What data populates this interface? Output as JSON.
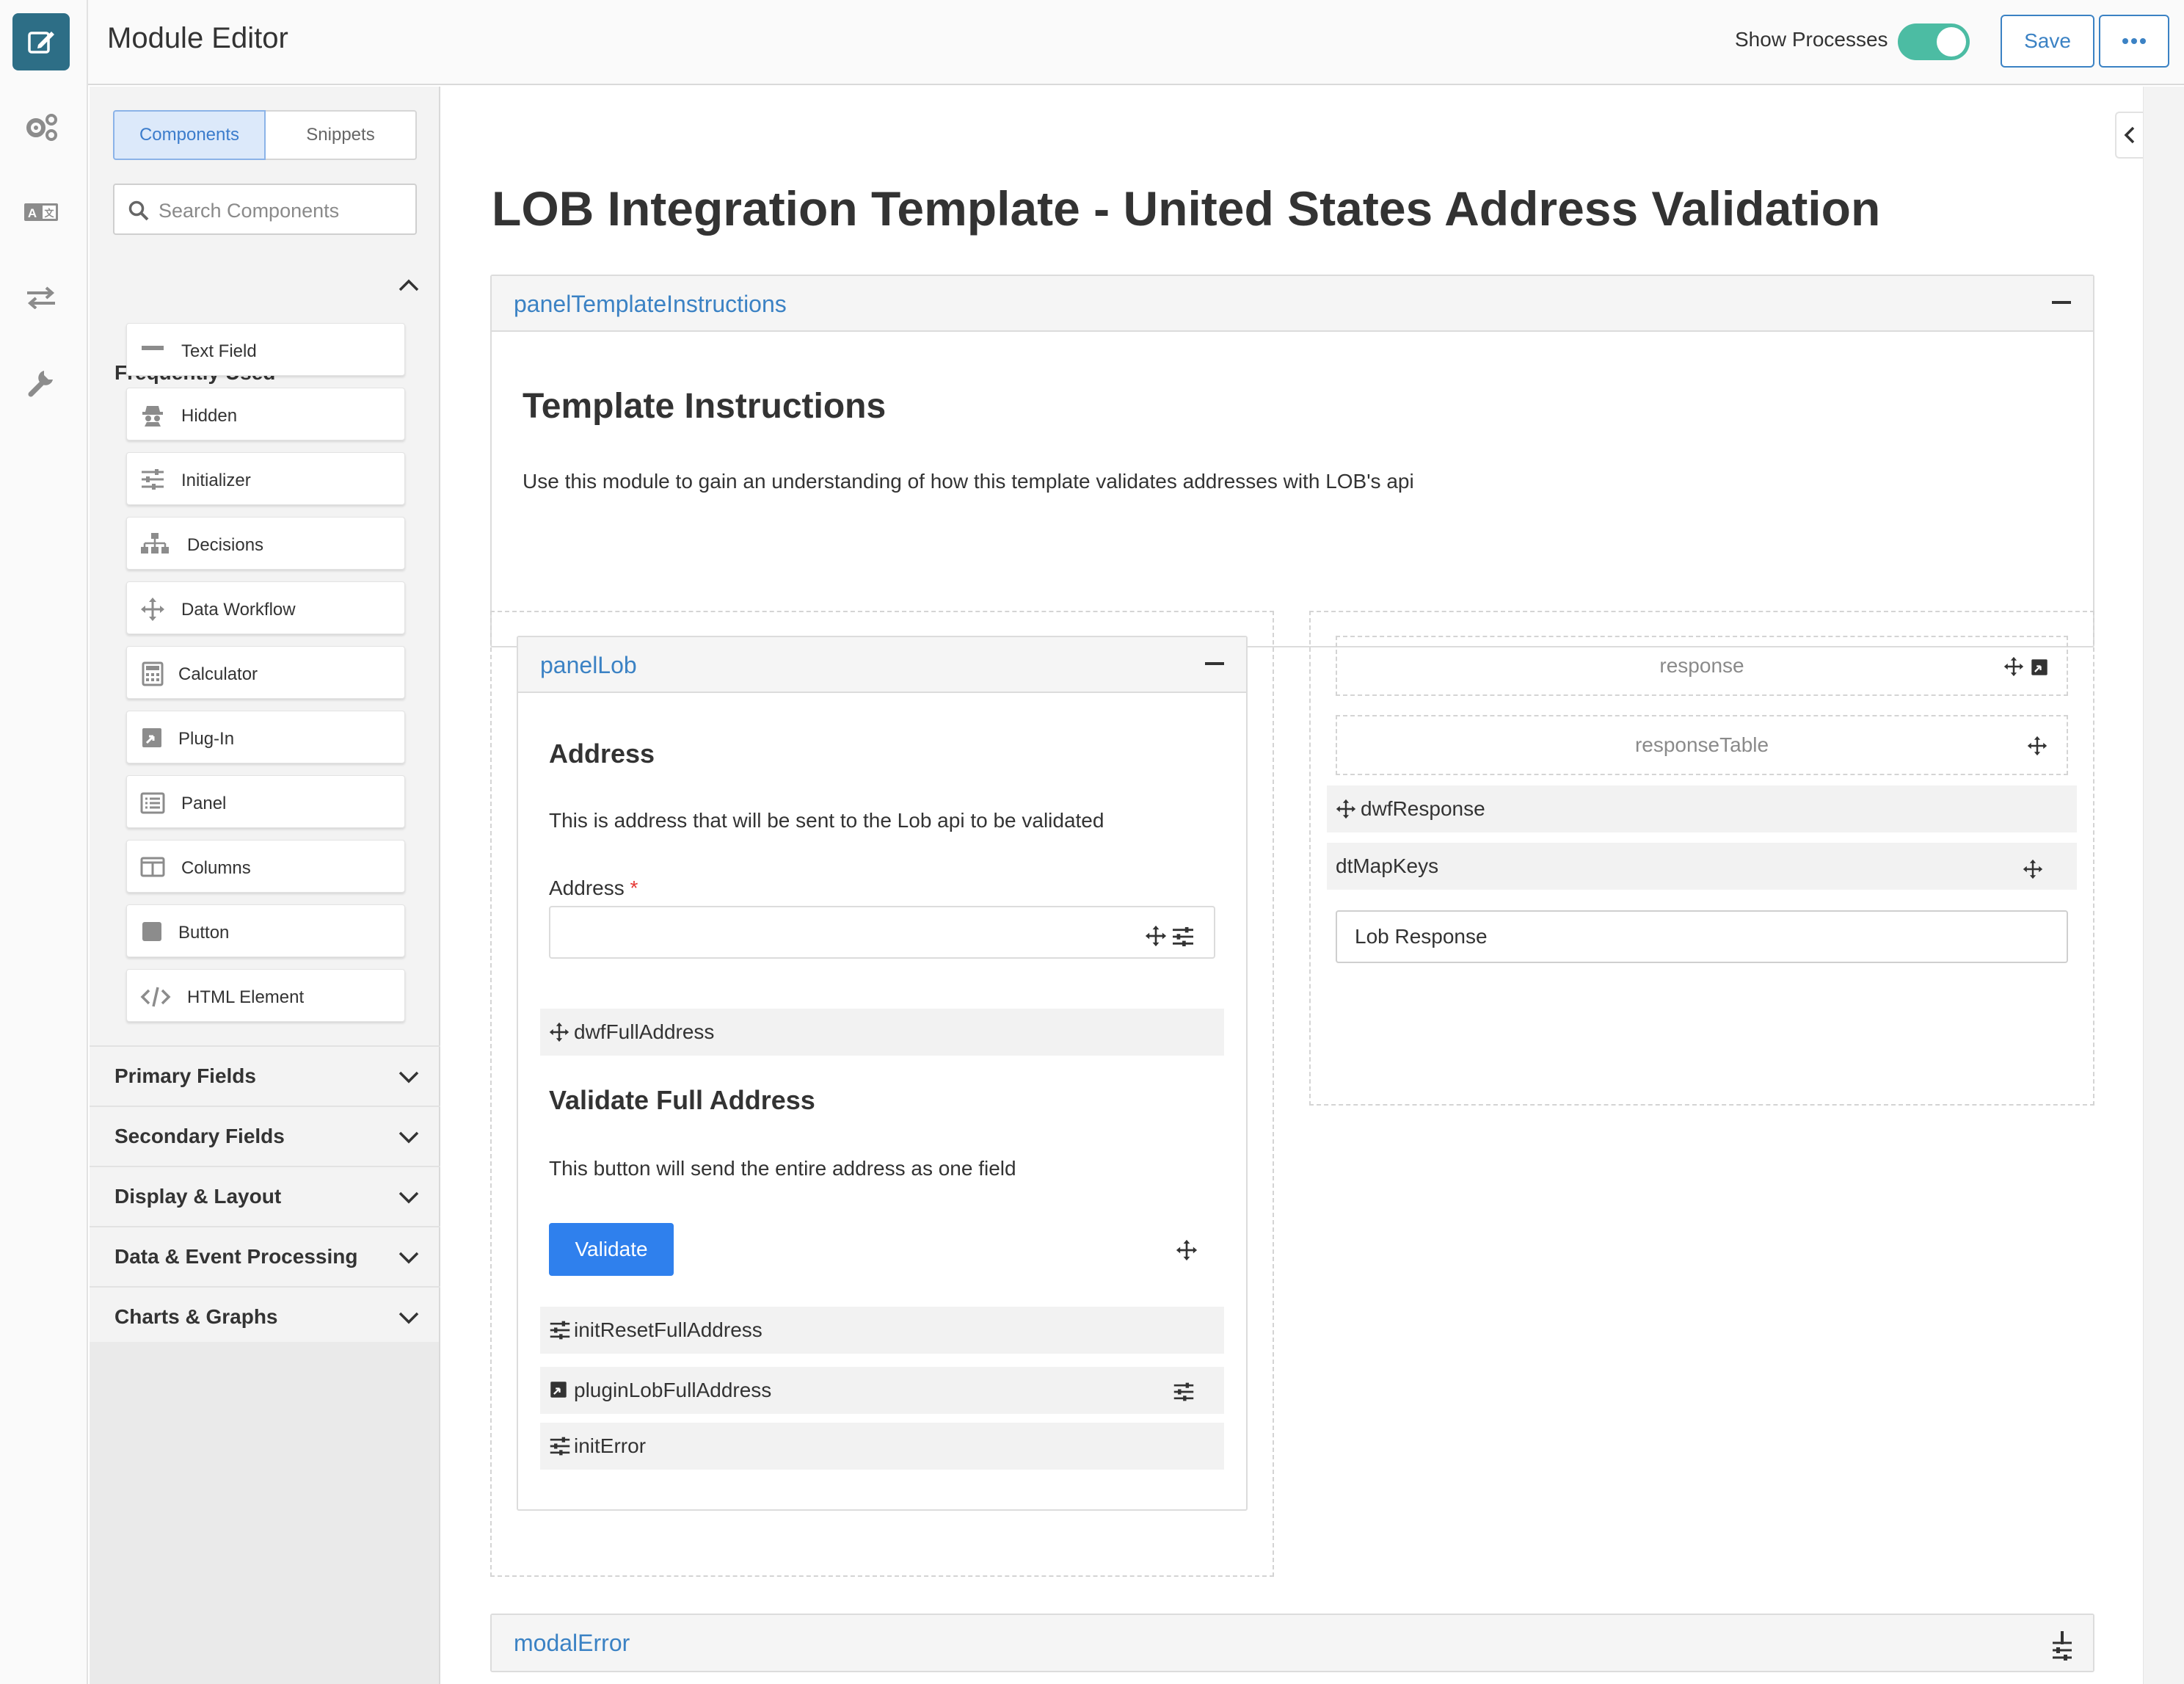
{
  "header": {
    "title": "Module Editor",
    "show_processes_label": "Show Processes",
    "show_processes_on": true,
    "save_label": "Save",
    "more_label": "•••"
  },
  "rail": {
    "items": [
      "edit-icon",
      "settings-gears-icon",
      "translate-icon",
      "transfer-arrows-icon",
      "wrench-icon"
    ]
  },
  "sidebar": {
    "tabs": [
      "Components",
      "Snippets"
    ],
    "active_tab": "Components",
    "search_placeholder": "Search Components",
    "frequently_used_label": "Frequently Used",
    "components": [
      {
        "label": "Text Field",
        "icon": "text-field-icon"
      },
      {
        "label": "Hidden",
        "icon": "hidden-spy-icon"
      },
      {
        "label": "Initializer",
        "icon": "initializer-sliders-icon"
      },
      {
        "label": "Decisions",
        "icon": "decisions-sitemap-icon"
      },
      {
        "label": "Data Workflow",
        "icon": "data-workflow-move-icon"
      },
      {
        "label": "Calculator",
        "icon": "calculator-icon"
      },
      {
        "label": "Plug-In",
        "icon": "plugin-icon"
      },
      {
        "label": "Panel",
        "icon": "panel-list-icon"
      },
      {
        "label": "Columns",
        "icon": "columns-icon"
      },
      {
        "label": "Button",
        "icon": "button-square-icon"
      },
      {
        "label": "HTML Element",
        "icon": "code-icon"
      }
    ],
    "sections": [
      "Primary Fields",
      "Secondary Fields",
      "Display & Layout",
      "Data & Event Processing",
      "Charts & Graphs"
    ]
  },
  "canvas": {
    "page_title": "LOB Integration Template - United States Address Validation",
    "instructions_panel": {
      "title": "panelTemplateInstructions",
      "heading": "Template Instructions",
      "body": "Use this module to gain an understanding of how this template validates addresses with LOB's api"
    },
    "panel_lob": {
      "title": "panelLob",
      "address_heading": "Address",
      "address_desc": "This is address that will be sent to the Lob api to be validated",
      "address_label": "Address",
      "required_mark": "*",
      "dwf_full_address": "dwfFullAddress",
      "validate_heading": "Validate Full Address",
      "validate_desc": "This button will send the entire address as one field",
      "validate_button": "Validate",
      "init_reset": "initResetFullAddress",
      "plugin_lob": "pluginLobFullAddress",
      "init_error": "initError"
    },
    "right_column": {
      "response": "response",
      "response_table": "responseTable",
      "dwf_response": "dwfResponse",
      "dt_map_keys": "dtMapKeys",
      "lob_response_value": "Lob Response"
    },
    "modal_error": {
      "title": "modalError"
    }
  },
  "colors": {
    "accent_blue": "#3b82c4",
    "validate_blue": "#2f80ed",
    "toggle_green": "#4cbca3",
    "rail_active": "#2d6e86",
    "required_red": "#e53935"
  }
}
